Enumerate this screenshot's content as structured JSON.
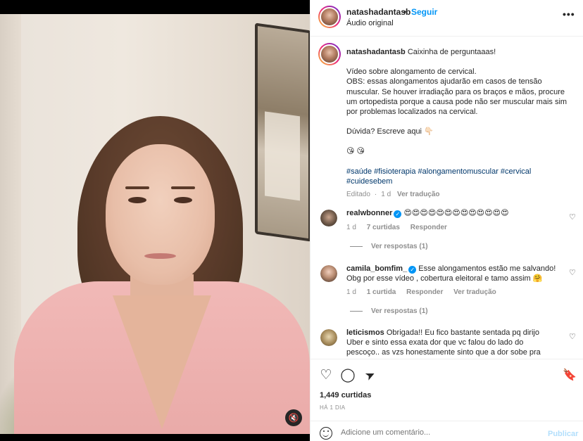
{
  "post": {
    "username": "natashadantasb",
    "separator": "•",
    "follow_label": "Seguir",
    "audio_label": "Áudio original",
    "more_label": "•••"
  },
  "caption": {
    "username": "natashadantasb",
    "line1": "Caixinha de perguntaaas!",
    "line2": "Vídeo sobre alongamento de cervical.",
    "line3": "OBS: essas alongamentos ajudarão em casos de tensão muscular. Se houver irradiação para os braços e mãos, procure um ortopedista porque a causa pode não ser muscular mais sim por problemas localizados na cervical.",
    "line4": "Dúvida? Escreve aqui 👇🏻",
    "emojis": "😘 😘",
    "hashtags": "#saúde #fisioterapia #alongamentomuscular #cervical #cuidesebem",
    "edited": "Editado",
    "dot": "·",
    "time": "1 d",
    "translate": "Ver tradução"
  },
  "comments": [
    {
      "username": "realwbonner",
      "verified": true,
      "text": "😍😍😍😍😍😍😍😍😍😍😍😍😍",
      "time": "1 d",
      "likes": "7 curtidas",
      "reply": "Responder",
      "translate": "",
      "view_replies": "Ver respostas (1)"
    },
    {
      "username": "camila_bomfim_",
      "verified": true,
      "text": "Esse alongamentos estão me salvando! Obg por esse vídeo , cobertura eleitoral e tamo assim 🤗",
      "time": "1 d",
      "likes": "1 curtida",
      "reply": "Responder",
      "translate": "Ver tradução",
      "view_replies": "Ver respostas (1)"
    },
    {
      "username": "leticismos",
      "verified": false,
      "text": "Obrigada!! Eu fico bastante sentada pq dirijo Uber e sinto essa exata dor que vc falou do lado do pescoço.. as vzs honestamente sinto que a dor sobe pra orelha, e olha que"
    }
  ],
  "actions": {
    "likes": "1,449 curtidas",
    "date": "HÁ 1 DIA"
  },
  "add_comment": {
    "placeholder": "Adicione um comentário...",
    "publish_label": "Publicar"
  },
  "icons": {
    "heart": "♡",
    "comment": "◯",
    "share": "➤",
    "save": "🔖",
    "mute": "🔇",
    "small_heart": "♡"
  },
  "colors": {
    "accent": "#0095f6",
    "text": "#262626",
    "muted": "#8e8e8e",
    "hashtag": "#00376b",
    "publish_disabled": "#b2dffc"
  }
}
